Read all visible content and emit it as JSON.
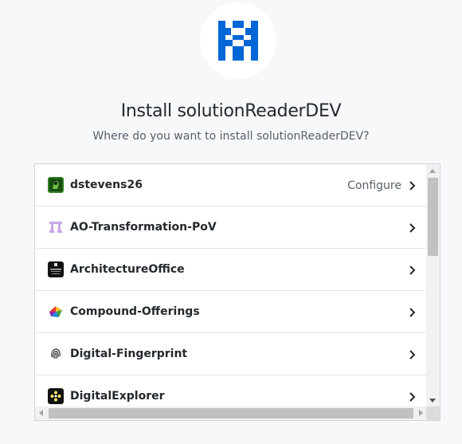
{
  "app": {
    "name": "solutionReaderDEV",
    "logo_icon": "solutionreader-logo",
    "brand_color": "#0366d6"
  },
  "header": {
    "title": "Install solutionReaderDEV",
    "subtitle": "Where do you want to install solutionReaderDEV?"
  },
  "accounts": [
    {
      "name": "dstevens26",
      "action_label": "Configure",
      "avatar_icon": "user-avatar-icon"
    },
    {
      "name": "AO-Transformation-PoV",
      "action_label": "",
      "avatar_icon": "org-avatar-icon"
    },
    {
      "name": "ArchitectureOffice",
      "action_label": "",
      "avatar_icon": "org-avatar-icon"
    },
    {
      "name": "Compound-Offerings",
      "action_label": "",
      "avatar_icon": "org-avatar-icon"
    },
    {
      "name": "Digital-Fingerprint",
      "action_label": "",
      "avatar_icon": "fingerprint-icon"
    },
    {
      "name": "DigitalExplorer",
      "action_label": "",
      "avatar_icon": "org-avatar-icon"
    }
  ],
  "colors": {
    "page_bg": "#f6f8fa",
    "text_primary": "#24292e",
    "text_secondary": "#586069",
    "border": "#d1d5da"
  }
}
